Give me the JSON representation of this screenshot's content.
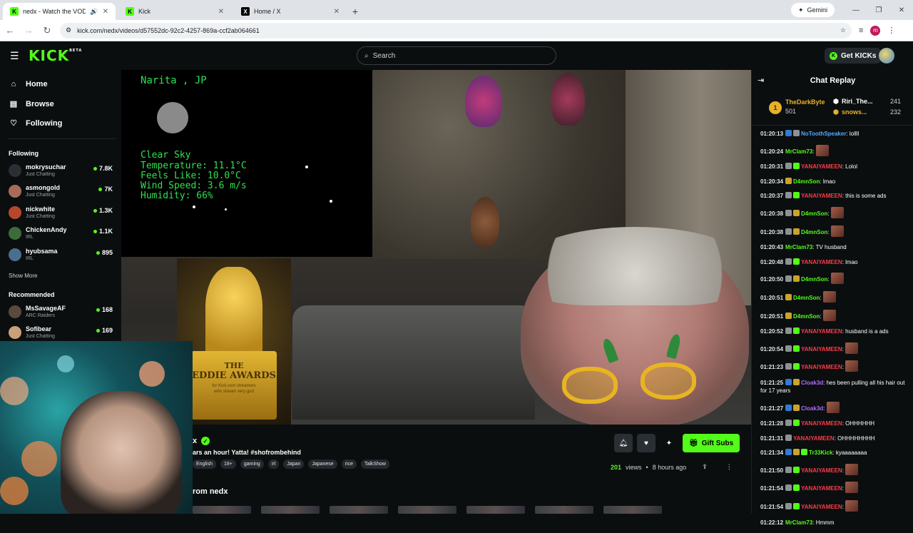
{
  "browser": {
    "tabs": [
      {
        "title": "nedx - Watch the VOD on",
        "favicon": "kick-icon",
        "active": true
      },
      {
        "title": "Kick",
        "favicon": "kick-icon",
        "active": false
      },
      {
        "title": "Home / X",
        "favicon": "x-icon",
        "active": false
      }
    ],
    "gemini_label": "Gemini",
    "url": "kick.com/nedx/videos/d57552dc-92c2-4257-869a-ccf2ab064661",
    "profile_initial": "m"
  },
  "header": {
    "logo": "KICK",
    "logo_badge": "BETA",
    "search_placeholder": "Search",
    "get_kicks_label": "Get KICKs"
  },
  "sidebar": {
    "nav": [
      {
        "label": "Home",
        "icon": "home-icon"
      },
      {
        "label": "Browse",
        "icon": "browse-icon"
      },
      {
        "label": "Following",
        "icon": "heart-icon"
      }
    ],
    "following_heading": "Following",
    "following": [
      {
        "name": "mokrysuchar",
        "category": "Just Chatting",
        "viewers": "7.8K"
      },
      {
        "name": "asmongold",
        "category": "Just Chatting",
        "viewers": "7K"
      },
      {
        "name": "nickwhite",
        "category": "Just Chatting",
        "viewers": "1.3K"
      },
      {
        "name": "ChickenAndy",
        "category": "IRL",
        "viewers": "1.1K"
      },
      {
        "name": "hyubsama",
        "category": "IRL",
        "viewers": "895"
      }
    ],
    "show_more": "Show More",
    "recommended_heading": "Recommended",
    "recommended": [
      {
        "name": "MsSavageAF",
        "category": "ARC Raiders",
        "viewers": "168"
      },
      {
        "name": "Sofibear",
        "category": "Just Chatting",
        "viewers": "169"
      }
    ]
  },
  "video": {
    "weather": {
      "location": "Narita , JP",
      "condition": "Clear Sky",
      "temperature": "Temperature: 11.1°C",
      "feels_like": "Feels Like: 10.0°C",
      "wind": "Wind Speed: 3.6 m/s",
      "humidity": "Humidity: 66%"
    },
    "trophy": {
      "line1": "THE",
      "line2": "EDDIE AWARDS",
      "line3": "for Kick.com streamers",
      "line4": "who stream very gud"
    }
  },
  "info": {
    "channel_fragment": "x",
    "title": "ars an hour! Yatta! #shofrombehind",
    "tags": [
      "English",
      "18+",
      "gaming",
      "irl",
      "Japan",
      "Japanese",
      "rice",
      "TalkShow"
    ],
    "gift_label": "Gift Subs",
    "views_count": "201",
    "views_label": "views",
    "time_ago": "8 hours ago",
    "from_heading": "rom nedx"
  },
  "chat": {
    "title": "Chat Replay",
    "top_gifter": {
      "rank": "1",
      "name": "TheDarkByte",
      "value": "501"
    },
    "gifter2": {
      "name": "Riri_The...",
      "value": "241"
    },
    "gifter3": {
      "name": "snows...",
      "value": "232"
    },
    "messages": [
      {
        "ts": "01:20:13",
        "user": "NoToothSpeaker",
        "color": "#53a9ff",
        "text": "lollll",
        "badges": [
          "blue",
          "grey"
        ]
      },
      {
        "ts": "01:20:24",
        "user": "MrClam73",
        "color": "#53fc18",
        "text": "",
        "emote": true,
        "badges": []
      },
      {
        "ts": "01:20:31",
        "user": "YANAIYAMEEN",
        "color": "#ff3b48",
        "text": "Lolol",
        "badges": [
          "grey",
          "green"
        ]
      },
      {
        "ts": "01:20:34",
        "user": "D4mnSon",
        "color": "#53fc18",
        "text": "lmao",
        "badges": [
          "gold"
        ]
      },
      {
        "ts": "01:20:37",
        "user": "YANAIYAMEEN",
        "color": "#ff3b48",
        "text": "this is some ads",
        "badges": [
          "grey",
          "green"
        ]
      },
      {
        "ts": "01:20:38",
        "user": "D4mnSon",
        "color": "#53fc18",
        "text": "",
        "emote": true,
        "badges": [
          "grey",
          "gold"
        ]
      },
      {
        "ts": "01:20:38",
        "user": "D4mnSon",
        "color": "#53fc18",
        "text": "",
        "emote": true,
        "badges": [
          "grey",
          "gold"
        ]
      },
      {
        "ts": "01:20:43",
        "user": "MrClam73",
        "color": "#53fc18",
        "text": "TV husband",
        "badges": []
      },
      {
        "ts": "01:20:48",
        "user": "YANAIYAMEEN",
        "color": "#ff3b48",
        "text": "lmao",
        "badges": [
          "grey",
          "green"
        ]
      },
      {
        "ts": "01:20:50",
        "user": "D4mnSon",
        "color": "#53fc18",
        "text": "",
        "emote": true,
        "badges": [
          "grey",
          "gold"
        ]
      },
      {
        "ts": "01:20:51",
        "user": "D4mnSon",
        "color": "#53fc18",
        "text": "",
        "emote": true,
        "badges": [
          "gold"
        ]
      },
      {
        "ts": "01:20:51",
        "user": "D4mnSon",
        "color": "#53fc18",
        "text": "",
        "emote": true,
        "badges": [
          "gold"
        ]
      },
      {
        "ts": "01:20:52",
        "user": "YANAIYAMEEN",
        "color": "#ff3b48",
        "text": "husband is a ads",
        "badges": [
          "grey",
          "green"
        ]
      },
      {
        "ts": "01:20:54",
        "user": "YANAIYAMEEN",
        "color": "#ff3b48",
        "text": "",
        "emote": true,
        "badges": [
          "grey",
          "green"
        ]
      },
      {
        "ts": "01:21:23",
        "user": "YANAIYAMEEN",
        "color": "#ff3b48",
        "text": "",
        "emote": true,
        "badges": [
          "grey",
          "green"
        ]
      },
      {
        "ts": "01:21:25",
        "user": "Cloak3d",
        "color": "#b36cff",
        "text": "hes been pulling all his hair out for 17 years",
        "badges": [
          "blue",
          "gold"
        ]
      },
      {
        "ts": "01:21:27",
        "user": "Cloak3d",
        "color": "#b36cff",
        "text": "",
        "emote": true,
        "badges": [
          "blue",
          "gold"
        ]
      },
      {
        "ts": "01:21:28",
        "user": "YANAIYAMEEN",
        "color": "#ff3b48",
        "text": "OHHHHHH",
        "badges": [
          "grey",
          "green"
        ]
      },
      {
        "ts": "01:21:31",
        "user": "YANAIYAMEEN",
        "color": "#ff3b48",
        "text": "OHHHHHHHH",
        "badges": [
          "grey"
        ]
      },
      {
        "ts": "01:21:34",
        "user": "Tr33Kick",
        "color": "#53fc18",
        "text": "kyaaaaaaaa",
        "badges": [
          "blue",
          "gold",
          "green"
        ]
      },
      {
        "ts": "01:21:50",
        "user": "YANAIYAMEEN",
        "color": "#ff3b48",
        "text": "",
        "emote": true,
        "badges": [
          "grey",
          "green"
        ]
      },
      {
        "ts": "01:21:54",
        "user": "YANAIYAMEEN",
        "color": "#ff3b48",
        "text": "",
        "emote": true,
        "badges": [
          "grey",
          "green"
        ]
      },
      {
        "ts": "01:21:54",
        "user": "YANAIYAMEEN",
        "color": "#ff3b48",
        "text": "",
        "emote": true,
        "badges": [
          "grey",
          "green"
        ]
      },
      {
        "ts": "01:22:12",
        "user": "MrClam73",
        "color": "#53fc18",
        "text": "Hmmm",
        "badges": []
      }
    ]
  },
  "colors": {
    "kick_green": "#53fc18",
    "background": "#0b0e0f",
    "gold": "#e7b02b"
  }
}
